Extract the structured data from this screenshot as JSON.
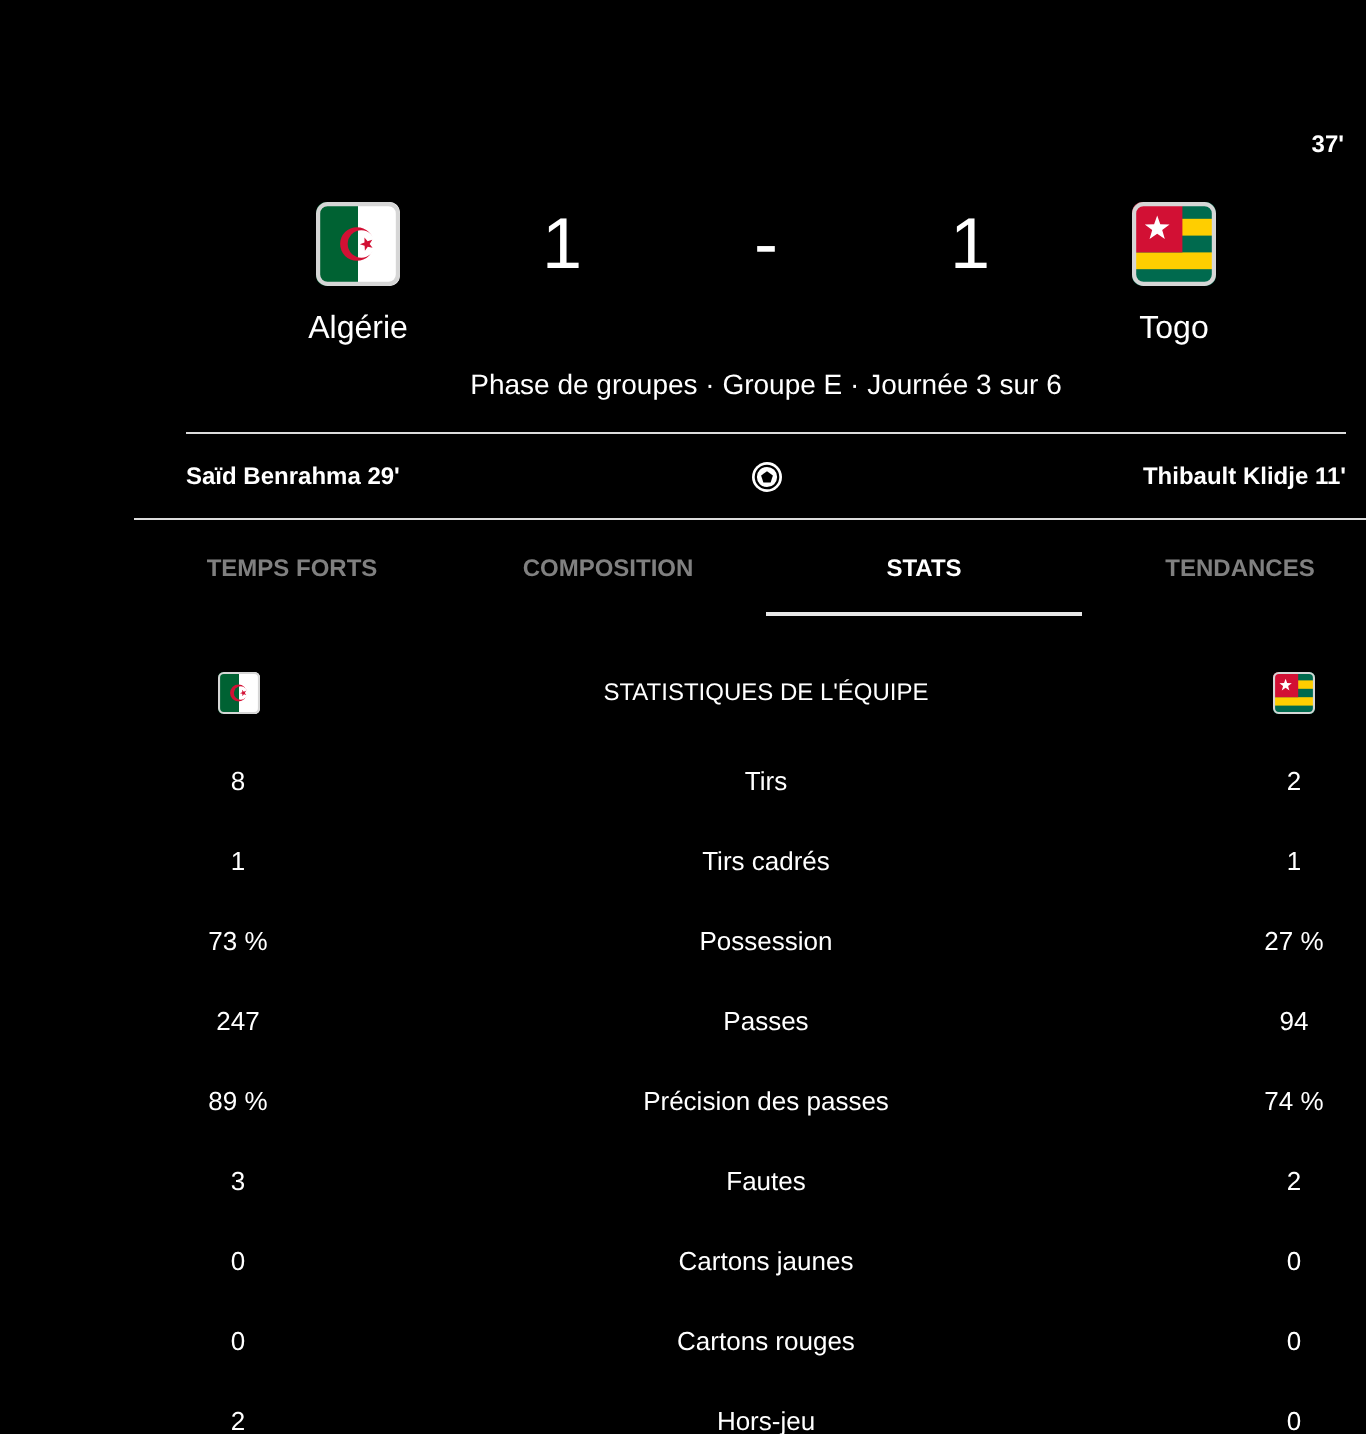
{
  "header": {
    "minute": "37'",
    "teams": [
      {
        "name": "Algérie",
        "score": "1"
      },
      {
        "name": "Togo",
        "score": "1"
      }
    ],
    "score_separator": "-",
    "stage": "Phase de groupes · Groupe E · Journée 3 sur 6"
  },
  "scorers": {
    "home": [
      "Saïd Benrahma 29'"
    ],
    "away": [
      "Thibault Klidje 11'"
    ]
  },
  "tabs": [
    {
      "label": "TEMPS FORTS",
      "selected": false
    },
    {
      "label": "COMPOSITION",
      "selected": false
    },
    {
      "label": "STATS",
      "selected": true
    },
    {
      "label": "TENDANCES",
      "selected": false
    }
  ],
  "stats": {
    "title": "STATISTIQUES DE L'ÉQUIPE",
    "rows": [
      {
        "label": "Tirs",
        "home": "8",
        "away": "2"
      },
      {
        "label": "Tirs cadrés",
        "home": "1",
        "away": "1"
      },
      {
        "label": "Possession",
        "home": "73 %",
        "away": "27 %"
      },
      {
        "label": "Passes",
        "home": "247",
        "away": "94"
      },
      {
        "label": "Précision des passes",
        "home": "89 %",
        "away": "74 %"
      },
      {
        "label": "Fautes",
        "home": "3",
        "away": "2"
      },
      {
        "label": "Cartons jaunes",
        "home": "0",
        "away": "0"
      },
      {
        "label": "Cartons rouges",
        "home": "0",
        "away": "0"
      },
      {
        "label": "Hors-jeu",
        "home": "2",
        "away": "0"
      }
    ]
  }
}
